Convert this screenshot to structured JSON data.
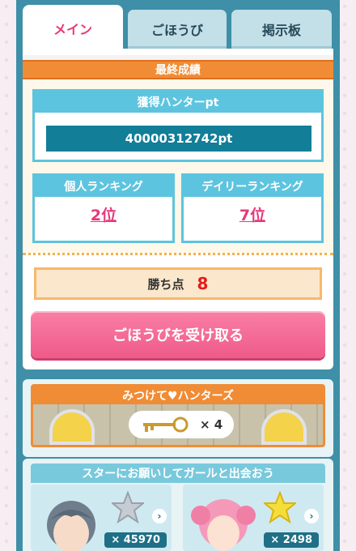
{
  "tabs": [
    {
      "label": "メイン",
      "active": true
    },
    {
      "label": "ごほうび",
      "active": false
    },
    {
      "label": "掲示板",
      "active": false
    }
  ],
  "result": {
    "header": "最終成績",
    "points_label": "獲得ハンターpt",
    "points_value": "40000312742pt",
    "personal_rank_label": "個人ランキング",
    "personal_rank_value": "2位",
    "daily_rank_label": "デイリーランキング",
    "daily_rank_value": "7位",
    "score_label": "勝ち点",
    "score_value": "8",
    "reward_button": "ごほうびを受け取る"
  },
  "hunters": {
    "title": "みつけて♥ハンターズ",
    "key_count": "× 4"
  },
  "stars": {
    "title": "スターにお願いしてガールと出会おう",
    "cards": [
      {
        "count": "× 45970",
        "star_color": "silver"
      },
      {
        "count": "× 2498",
        "star_color": "gold"
      }
    ]
  },
  "colors": {
    "accent_pink": "#e8387a",
    "orange": "#f08c35",
    "cyan": "#5dc4df",
    "teal_dark": "#127e98"
  }
}
